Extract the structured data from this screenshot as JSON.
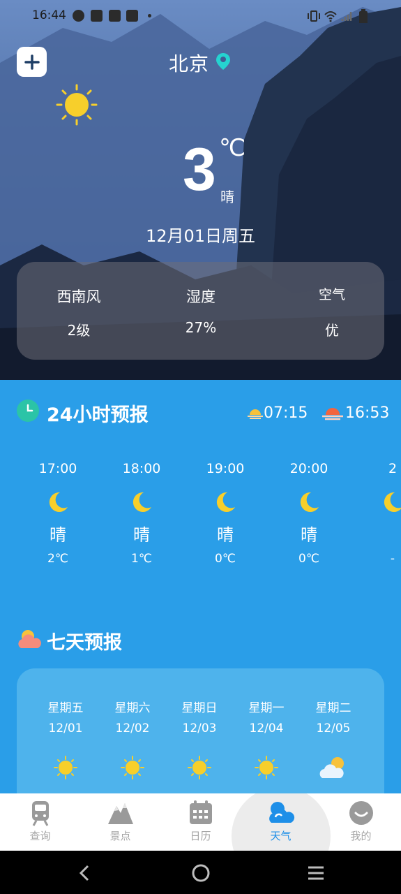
{
  "status_bar": {
    "time": "16:44"
  },
  "header": {
    "city": "北京"
  },
  "current": {
    "temperature": "3",
    "unit": "℃",
    "condition": "晴",
    "date": "12月01日周五"
  },
  "details": [
    {
      "label": "西南风",
      "value": "2级"
    },
    {
      "label": "湿度",
      "value": "27%"
    },
    {
      "label": "空气",
      "value": "优"
    }
  ],
  "hourly": {
    "title": "24小时预报",
    "sunrise": "07:15",
    "sunset": "16:53",
    "items": [
      {
        "hour": "17:00",
        "condition": "晴",
        "temp": "2℃",
        "icon": "moon-icon"
      },
      {
        "hour": "18:00",
        "condition": "晴",
        "temp": "1℃",
        "icon": "moon-icon"
      },
      {
        "hour": "19:00",
        "condition": "晴",
        "temp": "0℃",
        "icon": "moon-icon"
      },
      {
        "hour": "20:00",
        "condition": "晴",
        "temp": "0℃",
        "icon": "moon-icon"
      },
      {
        "hour": "2",
        "condition": "",
        "temp": "-",
        "icon": "moon-icon"
      }
    ]
  },
  "weekly": {
    "title": "七天预报",
    "days": [
      {
        "day": "星期五",
        "date": "12/01",
        "icon": "sun-icon"
      },
      {
        "day": "星期六",
        "date": "12/02",
        "icon": "sun-icon"
      },
      {
        "day": "星期日",
        "date": "12/03",
        "icon": "sun-icon"
      },
      {
        "day": "星期一",
        "date": "12/04",
        "icon": "sun-icon"
      },
      {
        "day": "星期二",
        "date": "12/05",
        "icon": "cloudy-sun-icon"
      }
    ]
  },
  "tabs": [
    {
      "label": "查询",
      "icon": "train-icon",
      "active": false
    },
    {
      "label": "景点",
      "icon": "mountain-icon",
      "active": false
    },
    {
      "label": "日历",
      "icon": "calendar-icon",
      "active": false
    },
    {
      "label": "天气",
      "icon": "weather-cloud-icon",
      "active": true
    },
    {
      "label": "我的",
      "icon": "profile-face-icon",
      "active": false
    }
  ],
  "colors": {
    "accent": "#1e8fe8",
    "panel_blue": "#2a9ee8",
    "sun_yellow": "#f7cf2b",
    "clock_teal": "#2bc4a7"
  }
}
